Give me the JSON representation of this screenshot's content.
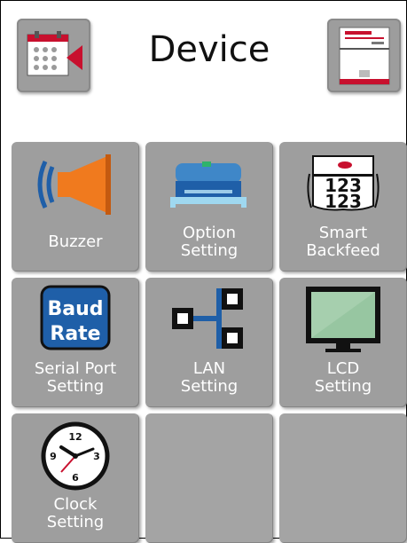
{
  "header": {
    "title": "Device",
    "back_icon": "calendar-back-icon",
    "next_icon": "printer-status-icon"
  },
  "tiles": [
    {
      "id": "buzzer",
      "label": "Buzzer",
      "icon": "speaker-icon"
    },
    {
      "id": "option",
      "label": "Option\nSetting",
      "icon": "printer-option-icon"
    },
    {
      "id": "backfeed",
      "label": "Smart\nBackfeed",
      "icon": "label-123-icon",
      "icon_text": "123"
    },
    {
      "id": "serial",
      "label": "Serial Port\nSetting",
      "icon": "baud-rate-icon",
      "icon_text_1": "Baud",
      "icon_text_2": "Rate"
    },
    {
      "id": "lan",
      "label": "LAN\nSetting",
      "icon": "network-icon"
    },
    {
      "id": "lcd",
      "label": "LCD\nSetting",
      "icon": "monitor-icon"
    },
    {
      "id": "clock",
      "label": "Clock\nSetting",
      "icon": "clock-icon",
      "clock_numbers": [
        "12",
        "3",
        "6",
        "9"
      ]
    }
  ],
  "colors": {
    "tile": "#9e9e9e",
    "accent_red": "#c8102e",
    "speaker_orange": "#f07a1e",
    "baud_blue": "#1f5fa8"
  }
}
